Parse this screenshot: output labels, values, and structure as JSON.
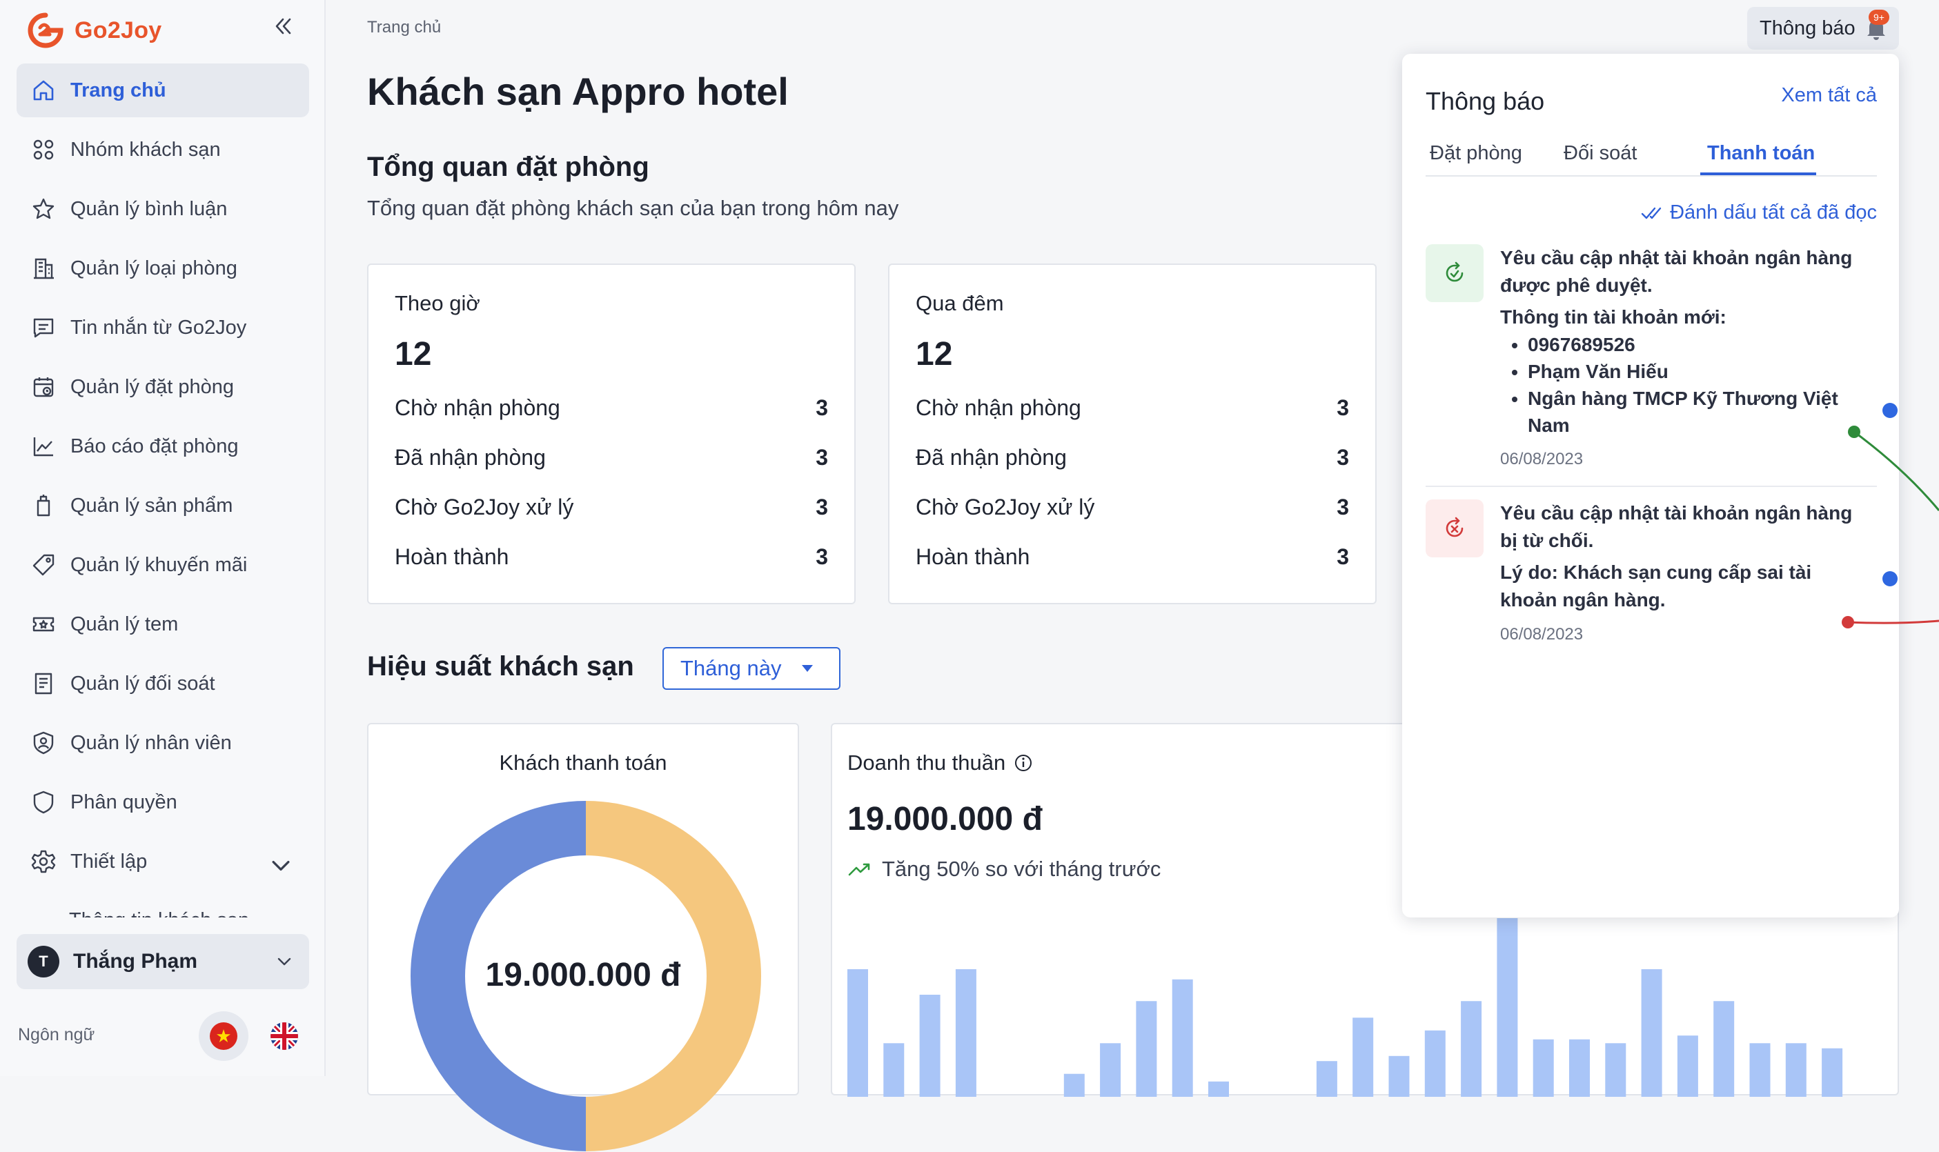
{
  "app": {
    "brand": "Go2Joy"
  },
  "sidebar": {
    "items": [
      {
        "label": "Trang chủ",
        "icon": "home-icon"
      },
      {
        "label": "Nhóm khách sạn",
        "icon": "grid-icon"
      },
      {
        "label": "Quản lý bình luận",
        "icon": "star-icon"
      },
      {
        "label": "Quản lý loại phòng",
        "icon": "building-icon"
      },
      {
        "label": "Tin nhắn từ Go2Joy",
        "icon": "message-icon"
      },
      {
        "label": "Quản lý đặt phòng",
        "icon": "calendar-icon"
      },
      {
        "label": "Báo cáo đặt phòng",
        "icon": "line-chart-icon"
      },
      {
        "label": "Quản lý sản phẩm",
        "icon": "product-icon"
      },
      {
        "label": "Quản lý khuyến mãi",
        "icon": "tag-icon"
      },
      {
        "label": "Quản lý tem",
        "icon": "ticket-icon"
      },
      {
        "label": "Quản lý đối soát",
        "icon": "receipt-icon"
      },
      {
        "label": "Quản lý nhân viên",
        "icon": "staff-icon"
      },
      {
        "label": "Phân quyền",
        "icon": "shield-icon"
      },
      {
        "label": "Thiết lập",
        "icon": "gear-icon"
      }
    ],
    "partial_item": "Thông tin khách sạn",
    "user": {
      "initial": "T",
      "name": "Thắng Phạm"
    },
    "language_label": "Ngôn ngữ"
  },
  "header": {
    "breadcrumb": "Trang chủ",
    "notification_button": "Thông báo",
    "notification_badge": "9+"
  },
  "main": {
    "title": "Khách sạn Appro hotel",
    "overview_title": "Tổng quan đặt phòng",
    "overview_subtitle": "Tổng quan đặt phòng khách sạn của bạn trong hôm nay",
    "cards": [
      {
        "label": "Theo giờ",
        "total": "12",
        "rows": [
          {
            "label": "Chờ nhận phòng",
            "value": "3"
          },
          {
            "label": "Đã nhận phòng",
            "value": "3"
          },
          {
            "label": "Chờ Go2Joy xử lý",
            "value": "3"
          },
          {
            "label": "Hoàn thành",
            "value": "3"
          }
        ]
      },
      {
        "label": "Qua đêm",
        "total": "12",
        "rows": [
          {
            "label": "Chờ nhận phòng",
            "value": "3"
          },
          {
            "label": "Đã nhận phòng",
            "value": "3"
          },
          {
            "label": "Chờ Go2Joy xử lý",
            "value": "3"
          },
          {
            "label": "Hoàn thành",
            "value": "3"
          }
        ]
      }
    ],
    "performance_title": "Hiệu suất khách sạn",
    "period_select": "Tháng này",
    "payment_card": {
      "title": "Khách thanh toán",
      "center_value": "19.000.000 đ"
    },
    "revenue_card": {
      "title": "Doanh thu thuần",
      "value": "19.000.000 đ",
      "trend": "Tăng 50% so với tháng trước"
    }
  },
  "notifications": {
    "title": "Thông báo",
    "view_all": "Xem tất cả",
    "tabs": [
      "Đặt phòng",
      "Đối soát",
      "Thanh toán"
    ],
    "active_tab": "Thanh toán",
    "mark_all_read": "Đánh dấu tất cả đã đọc",
    "items": [
      {
        "status": "approved",
        "title": "Yêu cầu cập nhật tài khoản ngân hàng được phê duyệt.",
        "subtitle": "Thông tin tài khoản mới:",
        "details": [
          "0967689526",
          "Phạm Văn Hiếu",
          "Ngân hàng TMCP Kỹ Thương Việt Nam"
        ],
        "date": "06/08/2023",
        "unread": true
      },
      {
        "status": "rejected",
        "title": "Yêu cầu cập nhật tài khoản ngân hàng bị từ chối.",
        "reason": "Lý do: Khách sạn cung cấp sai tài khoản ngân hàng.",
        "date": "06/08/2023",
        "unread": true
      }
    ]
  },
  "colors": {
    "accent": "#2e5fd8",
    "brand": "#e8542b",
    "pie_a": "#f5c77e",
    "pie_b": "#6a8bd8",
    "bar": "#a9c5f7",
    "success": "#2e8b3a",
    "danger": "#d23a3a"
  },
  "chart_data": [
    {
      "type": "pie",
      "title": "Khách thanh toán",
      "center_label": "19.000.000 đ",
      "slices": [
        {
          "value": 50,
          "color": "#f5c77e"
        },
        {
          "value": 50,
          "color": "#6a8bd8"
        }
      ]
    },
    {
      "type": "bar",
      "title": "Doanh thu thuần",
      "values": [
        100,
        42,
        80,
        100,
        0,
        0,
        18,
        42,
        75,
        92,
        12,
        0,
        0,
        28,
        62,
        32,
        52,
        75,
        140,
        45,
        45,
        42,
        100,
        48,
        75,
        42,
        42,
        38
      ],
      "ylim": [
        0,
        140
      ]
    }
  ]
}
